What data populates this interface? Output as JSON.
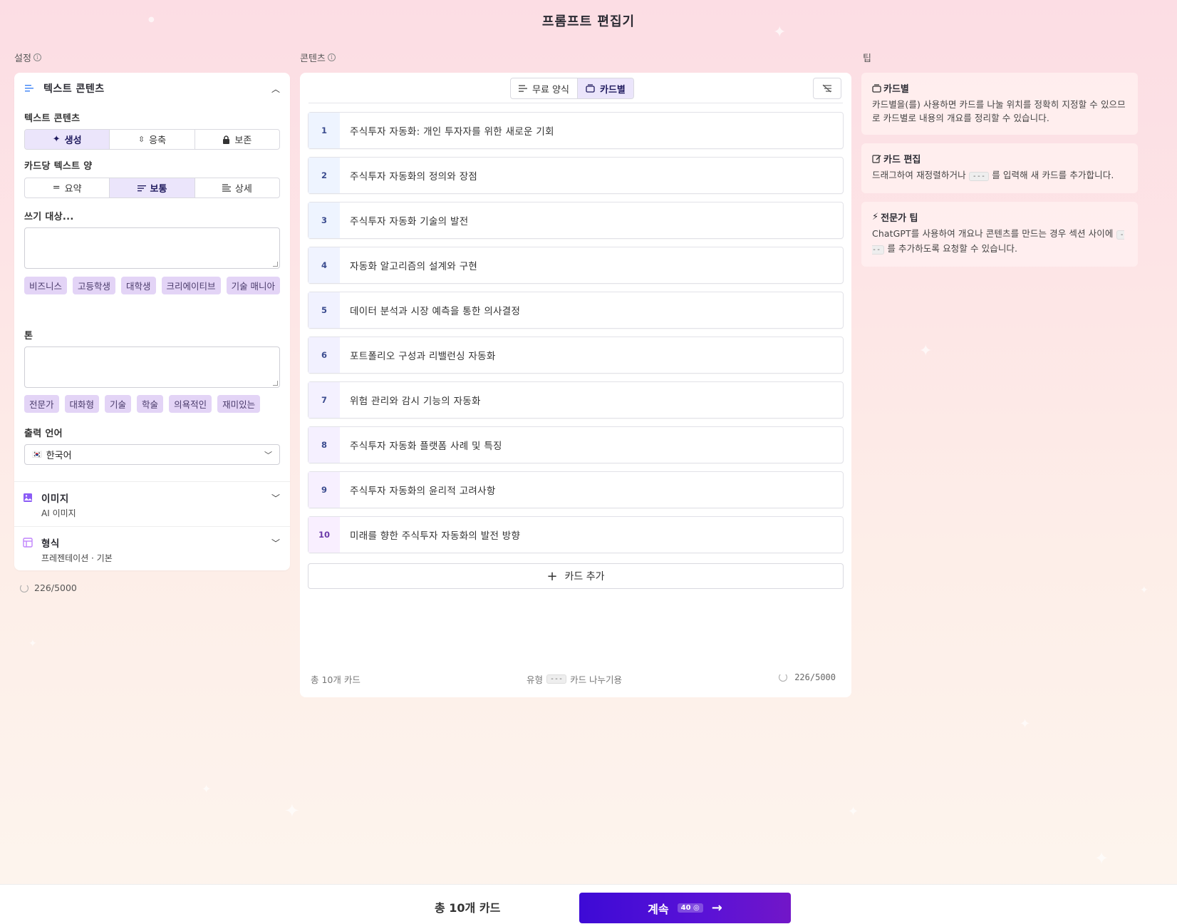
{
  "page": {
    "title": "프롬프트 편집기"
  },
  "columns": {
    "settings_label": "설정",
    "content_label": "콘텐츠",
    "tips_label": "팁"
  },
  "settings": {
    "text_section": {
      "title": "텍스트 콘텐츠",
      "mode_label": "텍스트 콘텐츠",
      "modes": [
        "생성",
        "응축",
        "보존"
      ],
      "amount_label": "카드당 텍스트 양",
      "amounts": [
        "요약",
        "보통",
        "상세"
      ],
      "audience_label": "쓰기 대상...",
      "audience_value": "",
      "audience_chips": [
        "비즈니스",
        "고등학생",
        "대학생",
        "크리에이티브",
        "기술 매니아"
      ],
      "tone_label": "톤",
      "tone_value": "",
      "tone_chips": [
        "전문가",
        "대화형",
        "기술",
        "학술",
        "의욕적인",
        "재미있는"
      ],
      "language_label": "출력 언어",
      "language_value": "한국어"
    },
    "image_section": {
      "title": "이미지",
      "subtitle": "AI 이미지"
    },
    "format_section": {
      "title": "형식",
      "subtitle": "프레젠테이션 · 기본"
    },
    "counter": "226/5000"
  },
  "content": {
    "modes": [
      "무료 양식",
      "카드별"
    ],
    "cards": [
      {
        "num": "1",
        "text": "주식투자 자동화: 개인 투자자를 위한 새로운 기회"
      },
      {
        "num": "2",
        "text": "주식투자 자동화의 정의와 장점"
      },
      {
        "num": "3",
        "text": "주식투자 자동화 기술의 발전"
      },
      {
        "num": "4",
        "text": "자동화 알고리즘의 설계와 구현"
      },
      {
        "num": "5",
        "text": "데이터 분석과 시장 예측을 통한 의사결정"
      },
      {
        "num": "6",
        "text": "포트폴리오 구성과 리밸런싱 자동화"
      },
      {
        "num": "7",
        "text": "위험 관리와 감시 기능의 자동화"
      },
      {
        "num": "8",
        "text": "주식투자 자동화 플랫폼 사례 및 특징"
      },
      {
        "num": "9",
        "text": "주식투자 자동화의 윤리적 고려사항"
      },
      {
        "num": "10",
        "text": "미래를 향한 주식투자 자동화의 발전 방향"
      }
    ],
    "add_card_label": "카드 추가",
    "footer_total": "총 10개 카드",
    "footer_hint_prefix": "유형",
    "footer_hint_code": "---",
    "footer_hint_suffix": "카드 나누기용",
    "footer_counter": "226/5000"
  },
  "tips": [
    {
      "title": "카드별",
      "body": "카드별을(를) 사용하면 카드를 나눌 위치를 정확히 지정할 수 있으므로 카드별로 내용의 개요를 정리할 수 있습니다."
    },
    {
      "title": "카드 편집",
      "body_prefix": "드래그하여 재정렬하거나",
      "code": "---",
      "body_suffix": "를 입력해 새 카드를 추가합니다."
    },
    {
      "title": "전문가 팁",
      "body_prefix": "ChatGPT를 사용하여 개요나 콘텐츠를 만드는 경우 섹션 사이에",
      "code": "---",
      "body_suffix": "를 추가하도록 요청할 수 있습니다."
    }
  ],
  "bottom": {
    "total": "총 10개 카드",
    "continue_label": "계속",
    "credits": "40"
  },
  "colors": {
    "accent": "#4a0fd6",
    "active_bg": "#ebe5fb",
    "chip_bg": "#e3d4f6"
  }
}
